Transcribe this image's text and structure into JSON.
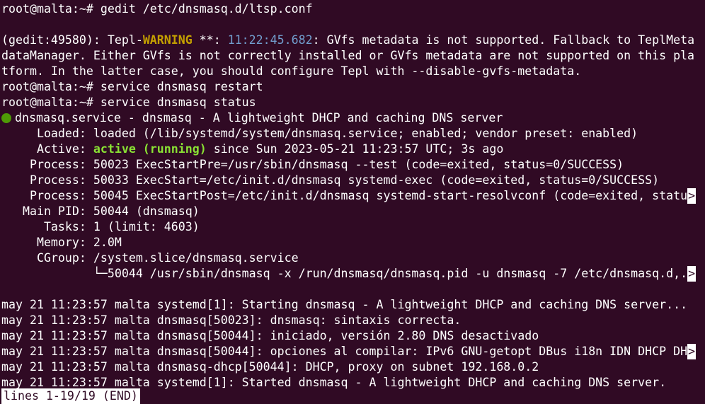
{
  "lines": {
    "l1": "root@malta:~# gedit /etc/dnsmasq.d/ltsp.conf",
    "l3a": "(gedit:49580): Tepl-",
    "l3warn": "WARNING",
    "l3b": " **: ",
    "l3time": "11:22:45.682",
    "l3c": ": GVfs metadata is not supported. Fallback to TeplMeta",
    "l4": "dataManager. Either GVfs is not correctly installed or GVfs metadata are not supported on this pla",
    "l5": "tform. In the latter case, you should configure Tepl with --disable-gvfs-metadata.",
    "l6": "root@malta:~# service dnsmasq restart",
    "l7": "root@malta:~# service dnsmasq status",
    "l8": "dnsmasq.service - dnsmasq - A lightweight DHCP and caching DNS server",
    "l9": "     Loaded: loaded (/lib/systemd/system/dnsmasq.service; enabled; vendor preset: enabled)",
    "l10a": "     Active: ",
    "l10active": "active (running)",
    "l10b": " since Sun 2023-05-21 11:23:57 UTC; 3s ago",
    "l11": "    Process: 50023 ExecStartPre=/usr/sbin/dnsmasq --test (code=exited, status=0/SUCCESS)",
    "l12": "    Process: 50033 ExecStart=/etc/init.d/dnsmasq systemd-exec (code=exited, status=0/SUCCESS)",
    "l13": "    Process: 50045 ExecStartPost=/etc/init.d/dnsmasq systemd-start-resolvconf (code=exited, statu",
    "l14": "   Main PID: 50044 (dnsmasq)",
    "l15": "      Tasks: 1 (limit: 4603)",
    "l16": "     Memory: 2.0M",
    "l17": "     CGroup: /system.slice/dnsmasq.service",
    "l18": "             └─50044 /usr/sbin/dnsmasq -x /run/dnsmasq/dnsmasq.pid -u dnsmasq -7 /etc/dnsmasq.d,.",
    "l20": "may 21 11:23:57 malta systemd[1]: Starting dnsmasq - A lightweight DHCP and caching DNS server...",
    "l21": "may 21 11:23:57 malta dnsmasq[50023]: dnsmasq: sintaxis correcta.",
    "l22": "may 21 11:23:57 malta dnsmasq[50044]: iniciado, versión 2.80 DNS desactivado",
    "l23": "may 21 11:23:57 malta dnsmasq[50044]: opciones al compilar: IPv6 GNU-getopt DBus i18n IDN DHCP DH",
    "l24": "may 21 11:23:57 malta dnsmasq-dhcp[50044]: DHCP, proxy on subnet 192.168.0.2",
    "l25": "may 21 11:23:57 malta systemd[1]: Started dnsmasq - A lightweight DHCP and caching DNS server.",
    "pager": "lines 1-19/19 (END)"
  },
  "truncation_marker": ">",
  "colors": {
    "background": "#300a24",
    "text": "#ffffff",
    "warning": "#c4a000",
    "timestamp": "#729fcf",
    "active": "#8ae234",
    "status_dot": "#4e9a06"
  }
}
